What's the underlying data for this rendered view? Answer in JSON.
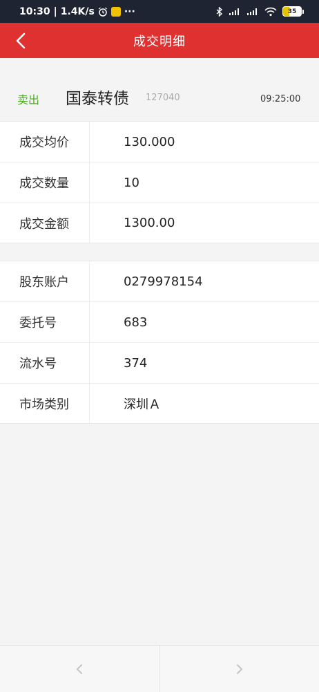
{
  "status_bar": {
    "time": "10:30",
    "speed": "1.4K/s",
    "more": "···",
    "battery": "35"
  },
  "header": {
    "title": "成交明细"
  },
  "stock": {
    "side": "卖出",
    "name": "国泰转债",
    "code": "127040",
    "time": "09:25:00"
  },
  "trade_table": [
    {
      "label": "成交均价",
      "value": "130.000"
    },
    {
      "label": "成交数量",
      "value": "10"
    },
    {
      "label": "成交金额",
      "value": "1300.00"
    }
  ],
  "account_table": [
    {
      "label": "股东账户",
      "value": "0279978154"
    },
    {
      "label": "委托号",
      "value": "683"
    },
    {
      "label": "流水号",
      "value": "374"
    },
    {
      "label": "市场类别",
      "value": "深圳Ａ"
    }
  ],
  "colors": {
    "header_bg": "#e03131",
    "sell_green": "#4caa1f",
    "status_bar_bg": "#1f2433"
  }
}
